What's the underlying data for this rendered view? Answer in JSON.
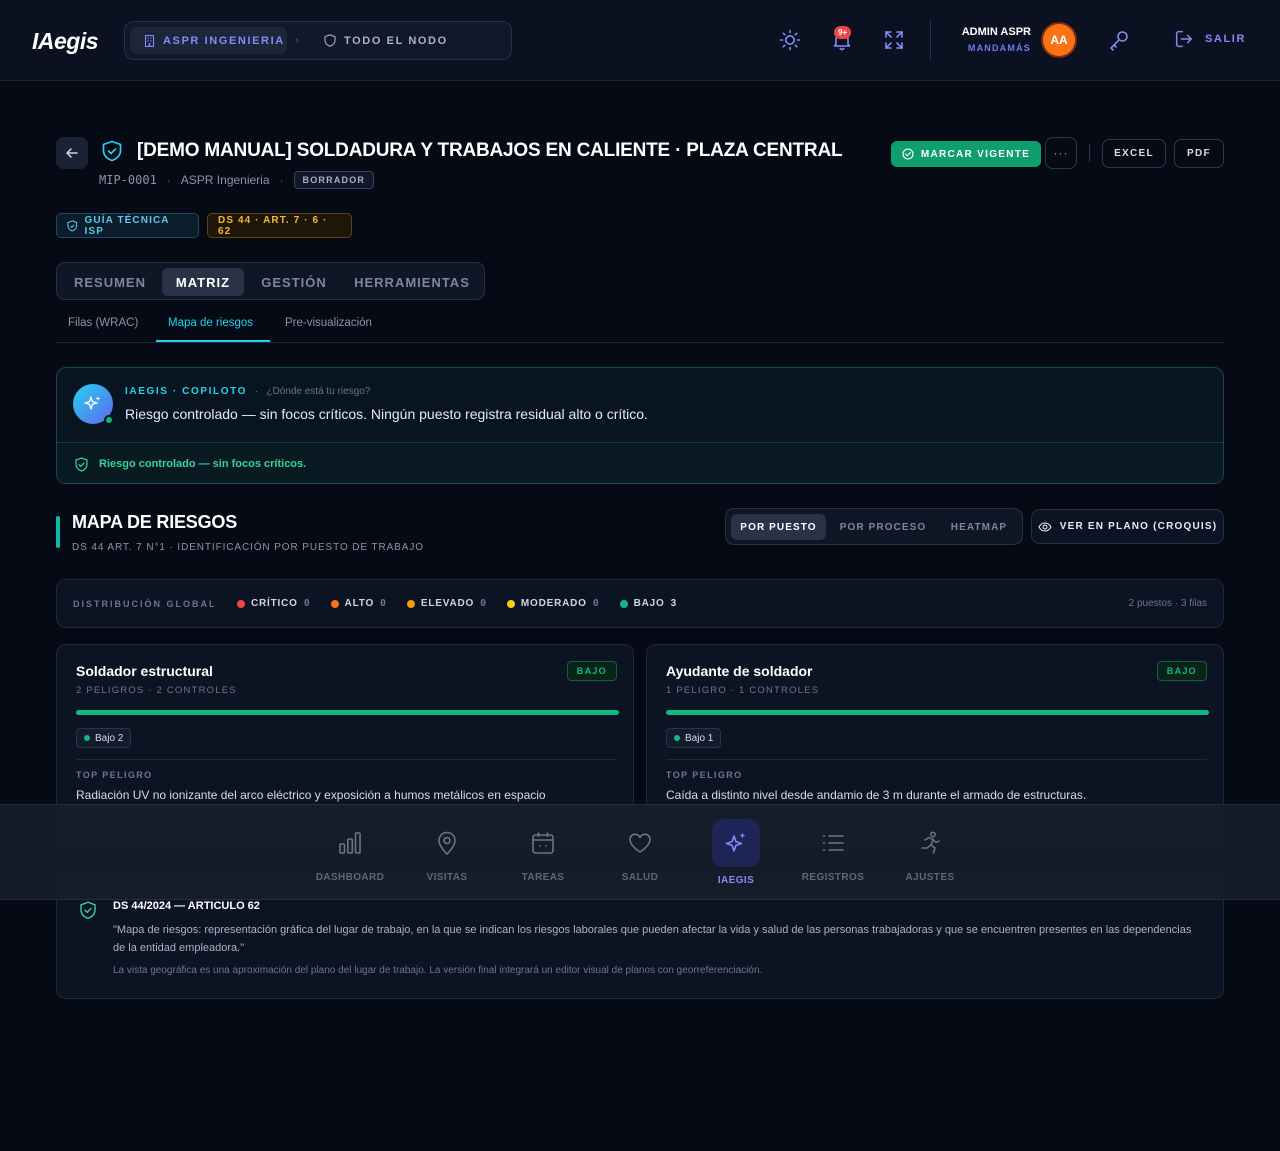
{
  "app": {
    "logo": "IAegis",
    "breadcrumb": [
      "ASPR INGENIERIA",
      "TODO EL NODO"
    ],
    "notifications_count": "9+",
    "user": {
      "name": "ADMIN ASPR",
      "role": "MANDAMÁS",
      "initials": "AA"
    },
    "logout_label": "SALIR"
  },
  "header": {
    "title": "[DEMO MANUAL] SOLDADURA Y TRABAJOS EN CALIENTE · PLAZA CENTRAL",
    "code": "MIP-0001",
    "company": "ASPR Ingenieria",
    "status": "BORRADOR",
    "actions": {
      "mark_current": "MARCAR VIGENTE",
      "more": "···",
      "excel": "EXCEL",
      "pdf": "PDF"
    },
    "tags": [
      "GUÍA TÉCNICA ISP",
      "DS 44 · ART. 7 · 6 · 62"
    ]
  },
  "tabs": [
    "RESUMEN",
    "MATRIZ",
    "GESTIÓN",
    "HERRAMIENTAS"
  ],
  "active_tab": "MATRIZ",
  "subtabs": [
    "Filas (WRAC)",
    "Mapa de riesgos",
    "Pre-visualización"
  ],
  "active_subtab": "Mapa de riesgos",
  "copilot": {
    "brand": "IAEGIS · COPILOTO",
    "sep": "·",
    "question": "¿Dónde está tu riesgo?",
    "message": "Riesgo controlado — sin focos críticos. Ningún puesto registra residual alto o crítico.",
    "footer": "Riesgo controlado — sin focos críticos."
  },
  "risk_map": {
    "title": "MAPA DE RIESGOS",
    "subtitle": "DS 44 ART. 7 N°1 · IDENTIFICACIÓN POR PUESTO DE TRABAJO",
    "views": [
      "POR PUESTO",
      "POR PROCESO",
      "HEATMAP"
    ],
    "active_view": "POR PUESTO",
    "plan_button": "VER EN PLANO (CROQUIS)",
    "distribution": {
      "label": "DISTRIBUCIÓN GLOBAL",
      "levels": [
        {
          "name": "CRÍTICO",
          "count": "0",
          "color": "#ef4444"
        },
        {
          "name": "ALTO",
          "count": "0",
          "color": "#f97316"
        },
        {
          "name": "ELEVADO",
          "count": "0",
          "color": "#f59e0b"
        },
        {
          "name": "MODERADO",
          "count": "0",
          "color": "#facc15"
        },
        {
          "name": "BAJO",
          "count": "3",
          "color": "#10b981"
        }
      ],
      "summary": "2 puestos · 3 filas"
    },
    "positions": [
      {
        "name": "Soldador estructural",
        "meta": "2 PELIGROS · 2 CONTROLES",
        "level": "BAJO",
        "chip": "Bajo 2",
        "bar_fraction": 1.0,
        "top_label": "TOP PELIGRO",
        "top_hazard": "Radiación UV no ionizante del arco eléctrico y exposición a humos metálicos en espacio"
      },
      {
        "name": "Ayudante de soldador",
        "meta": "1 PELIGRO · 1 CONTROLES",
        "level": "BAJO",
        "chip": "Bajo 1",
        "bar_fraction": 1.0,
        "top_label": "TOP PELIGRO",
        "top_hazard": "Caída a distinto nivel desde andamio de 3 m durante el armado de estructuras."
      }
    ]
  },
  "legal": {
    "title": "DS 44/2024 — ARTICULO 62",
    "quote": "\"Mapa de riesgos: representación gráfica del lugar de trabajo, en la que se indican los riesgos laborales que pueden afectar la vida y salud de las personas trabajadoras y que se encuentren presentes en las dependencias de la entidad empleadora.\"",
    "note": "La vista geográfica es una aproximación del plano del lugar de trabajo. La versión final integrará un editor visual de planos con georreferenciación."
  },
  "bottom_nav": [
    {
      "label": "DASHBOARD",
      "icon": "bar-chart-icon"
    },
    {
      "label": "VISITAS",
      "icon": "map-pin-icon"
    },
    {
      "label": "TAREAS",
      "icon": "calendar-icon"
    },
    {
      "label": "SALUD",
      "icon": "heart-icon"
    },
    {
      "label": "IAEGIS",
      "icon": "sparkles-icon"
    },
    {
      "label": "REGISTROS",
      "icon": "list-icon"
    },
    {
      "label": "AJUSTES",
      "icon": "runner-icon"
    }
  ],
  "active_nav": "IAEGIS",
  "colors": {
    "accent": "#818cf8",
    "teal": "#22d3ee",
    "success": "#10b981",
    "brand_orange": "#f97316"
  }
}
